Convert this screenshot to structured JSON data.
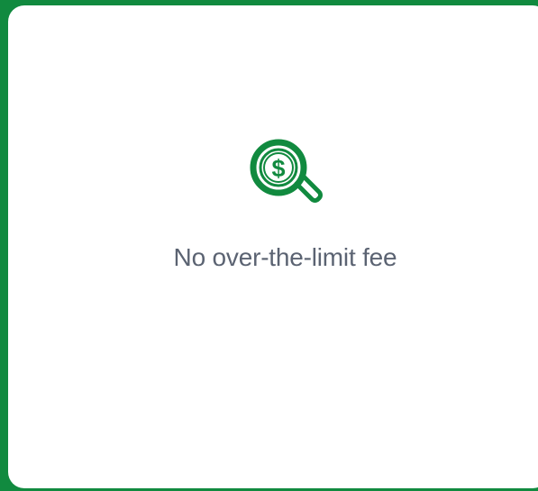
{
  "colors": {
    "border": "#118a3f",
    "card_background": "#ffffff",
    "icon": "#118a3f",
    "text": "#5b6372"
  },
  "feature": {
    "icon": "magnifying-glass-dollar-icon",
    "icon_symbol": "$",
    "label": "No over-the-limit fee"
  }
}
